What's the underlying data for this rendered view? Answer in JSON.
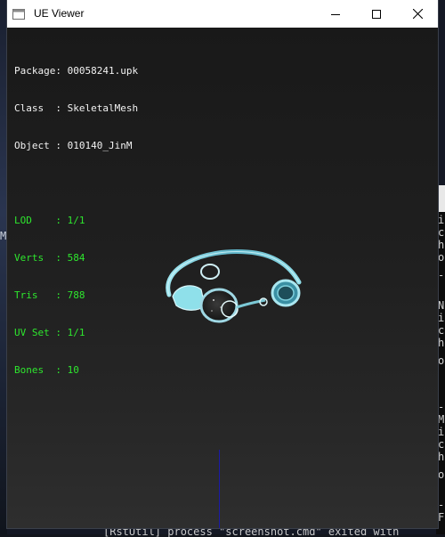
{
  "window": {
    "title": "UE Viewer",
    "controls": {
      "minimize_icon": "minimize-icon",
      "maximize_icon": "maximize-icon",
      "close_icon": "close-icon"
    }
  },
  "info_panel": {
    "package": {
      "label": "Package: ",
      "value": "00058241.upk"
    },
    "class": {
      "label": "Class  : ",
      "value": "SkeletalMesh"
    },
    "object": {
      "label": "Object : ",
      "value": "010140_JinM"
    },
    "lod": {
      "label": "LOD    : ",
      "value": "1/1"
    },
    "verts": {
      "label": "Verts  : ",
      "value": "584"
    },
    "tris": {
      "label": "Tris   : ",
      "value": "788"
    },
    "uvset": {
      "label": "UV Set : ",
      "value": "1/1"
    },
    "bones": {
      "label": "Bones  : ",
      "value": "10"
    }
  },
  "colors": {
    "header_text": "#f2f2f2",
    "stats_text": "#2ee62e",
    "model_tint": "#7fd8e8",
    "axis": "#1a1aa8"
  },
  "background": {
    "left_fragment": "M",
    "console_line": "[RstUtil] process \"screenshot.cmd\" exited with",
    "right_fragments": [
      "i",
      "c",
      "h",
      "o",
      "-",
      "N",
      "i",
      "c",
      "h",
      "o",
      "-",
      "M",
      "i",
      "c",
      "h",
      "o",
      "-",
      "F",
      "i"
    ]
  }
}
